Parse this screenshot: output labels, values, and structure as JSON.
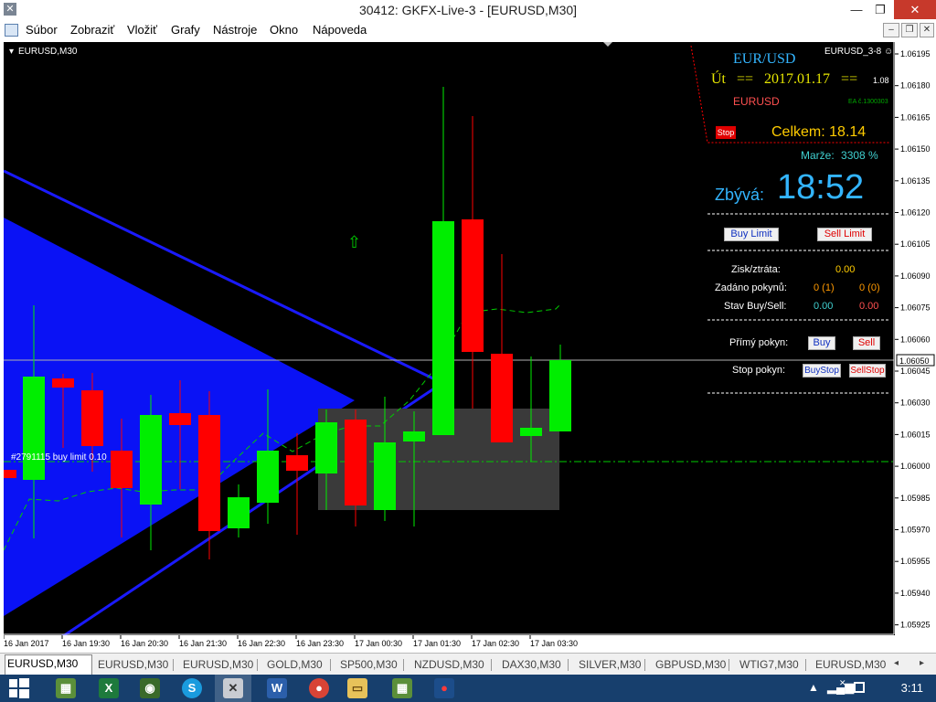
{
  "window": {
    "title": "30412: GKFX-Live-3 - [EURUSD,M30]",
    "minimize": "—",
    "maximize": "❐",
    "close": "✕"
  },
  "menu": [
    {
      "label": "Súbor"
    },
    {
      "label": "Zobraziť"
    },
    {
      "label": "Vložiť"
    },
    {
      "label": "Grafy"
    },
    {
      "label": "Nástroje"
    },
    {
      "label": "Okno"
    },
    {
      "label": "Nápoveda"
    }
  ],
  "chart": {
    "symbol_label": "EURUSD,M30",
    "ea_label": "EURUSD_3-8",
    "order_label": "#2791115 buy limit 0.10",
    "current_price": "1.06050",
    "price_ticks": [
      "1.06195",
      "1.06180",
      "1.06165",
      "1.06150",
      "1.06135",
      "1.06120",
      "1.06105",
      "1.06090",
      "1.06075",
      "1.06060",
      "1.06045",
      "1.06030",
      "1.06015",
      "1.06000",
      "1.05985",
      "1.05970",
      "1.05955",
      "1.05940",
      "1.05925"
    ],
    "time_ticks": [
      "16 Jan 2017",
      "16 Jan 19:30",
      "16 Jan 20:30",
      "16 Jan 21:30",
      "16 Jan 22:30",
      "16 Jan 23:30",
      "17 Jan 00:30",
      "17 Jan 01:30",
      "17 Jan 02:30",
      "17 Jan 03:30"
    ],
    "colors": {
      "bull": "#00ee00",
      "bear": "#ff0000",
      "triangle": "#1010ff",
      "background": "#000000"
    }
  },
  "panel": {
    "pair": "EUR/USD",
    "day": "Út",
    "eq_left": "==",
    "date": "2017.01.17",
    "eq_right": "==",
    "version": "1.08",
    "symbol": "EURUSD",
    "ea_id": "EA č.1300303",
    "stop_label": "Stop",
    "total_label": "Celkem:",
    "total_value": "18.14",
    "margin_label": "Marže:",
    "margin_value": "3308 %",
    "remaining_label": "Zbývá:",
    "remaining_value": "18:52",
    "buy_limit": "Buy Limit",
    "sell_limit": "Sell Limit",
    "pl_label": "Zisk/ztráta:",
    "pl_value": "0.00",
    "orders_label": "Zadáno pokynů:",
    "orders_buy": "0 (1)",
    "orders_sell": "0 (0)",
    "state_label": "Stav Buy/Sell:",
    "state_buy": "0.00",
    "state_sell": "0.00",
    "direct_label": "Přímý pokyn:",
    "buy": "Buy",
    "sell": "Sell",
    "stop_order_label": "Stop pokyn:",
    "buy_stop": "BuyStop",
    "sell_stop": "SellStop"
  },
  "tabs": [
    {
      "label": "EURUSD,M30",
      "active": true
    },
    {
      "label": "EURUSD,M30"
    },
    {
      "label": "EURUSD,M30"
    },
    {
      "label": "GOLD,M30"
    },
    {
      "label": "SP500,M30"
    },
    {
      "label": "NZDUSD,M30"
    },
    {
      "label": "DAX30,M30"
    },
    {
      "label": "SILVER,M30"
    },
    {
      "label": "GBPUSD,M30"
    },
    {
      "label": "WTIG7,M30"
    },
    {
      "label": "EURUSD,M30"
    }
  ],
  "taskbar": {
    "clock": "3:11"
  }
}
